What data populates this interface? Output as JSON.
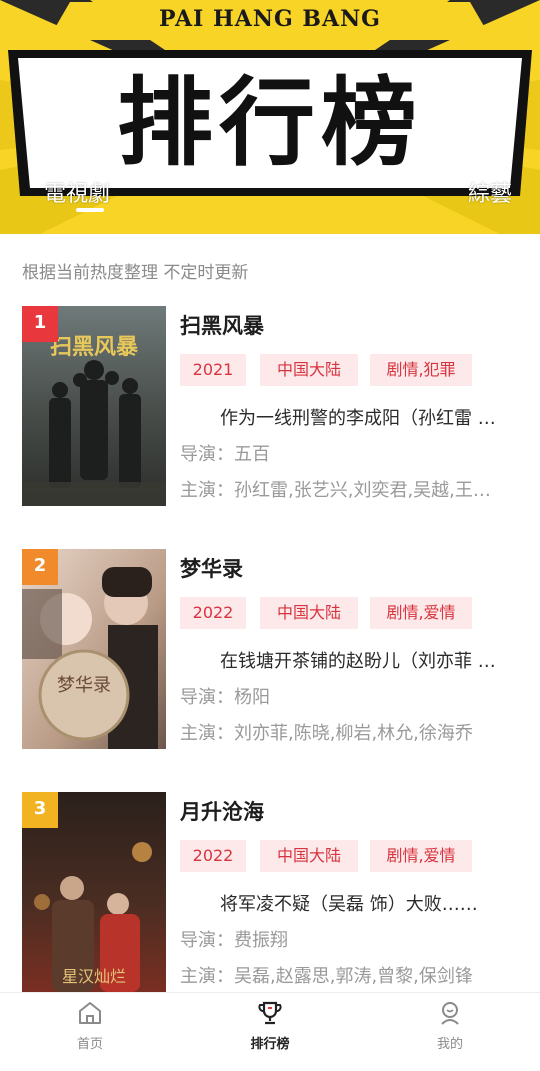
{
  "header": {
    "pinyin": "PAI HANG BANG",
    "title": "排行榜",
    "tabs": [
      {
        "label": "電視劇",
        "active": true
      },
      {
        "label": "綜藝",
        "active": false
      }
    ]
  },
  "subtitle": "根据当前热度整理 不定时更新",
  "items": [
    {
      "rank": "1",
      "rank_color": "#e8383d",
      "title": "扫黑风暴",
      "year": "2021",
      "region": "中国大陆",
      "genre": "剧情,犯罪",
      "desc": "作为一线刑警的李成阳（孙红雷 饰）……",
      "director": "导演：五百",
      "cast": "主演：孙红雷,张艺兴,刘奕君,吴越,王志飞"
    },
    {
      "rank": "2",
      "rank_color": "#f08a2a",
      "title": "梦华录",
      "year": "2022",
      "region": "中国大陆",
      "genre": "剧情,爱情",
      "desc": "在钱塘开茶铺的赵盼儿（刘亦菲 饰）……",
      "director": "导演：杨阳",
      "cast": "主演：刘亦菲,陈晓,柳岩,林允,徐海乔"
    },
    {
      "rank": "3",
      "rank_color": "#f2b322",
      "title": "月升沧海",
      "year": "2022",
      "region": "中国大陆",
      "genre": "剧情,爱情",
      "desc": "将军凌不疑（吴磊 饰）大败……",
      "director": "导演：费振翔",
      "cast": "主演：吴磊,赵露思,郭涛,曾黎,保剑锋"
    }
  ],
  "nav": [
    {
      "label": "首页",
      "icon": "home-icon",
      "active": false
    },
    {
      "label": "排行榜",
      "icon": "trophy-icon",
      "active": true
    },
    {
      "label": "我的",
      "icon": "profile-icon",
      "active": false
    }
  ],
  "colors": {
    "banner": "#f7d426",
    "tag_bg": "#fde9ea",
    "tag_text": "#d8343f"
  }
}
